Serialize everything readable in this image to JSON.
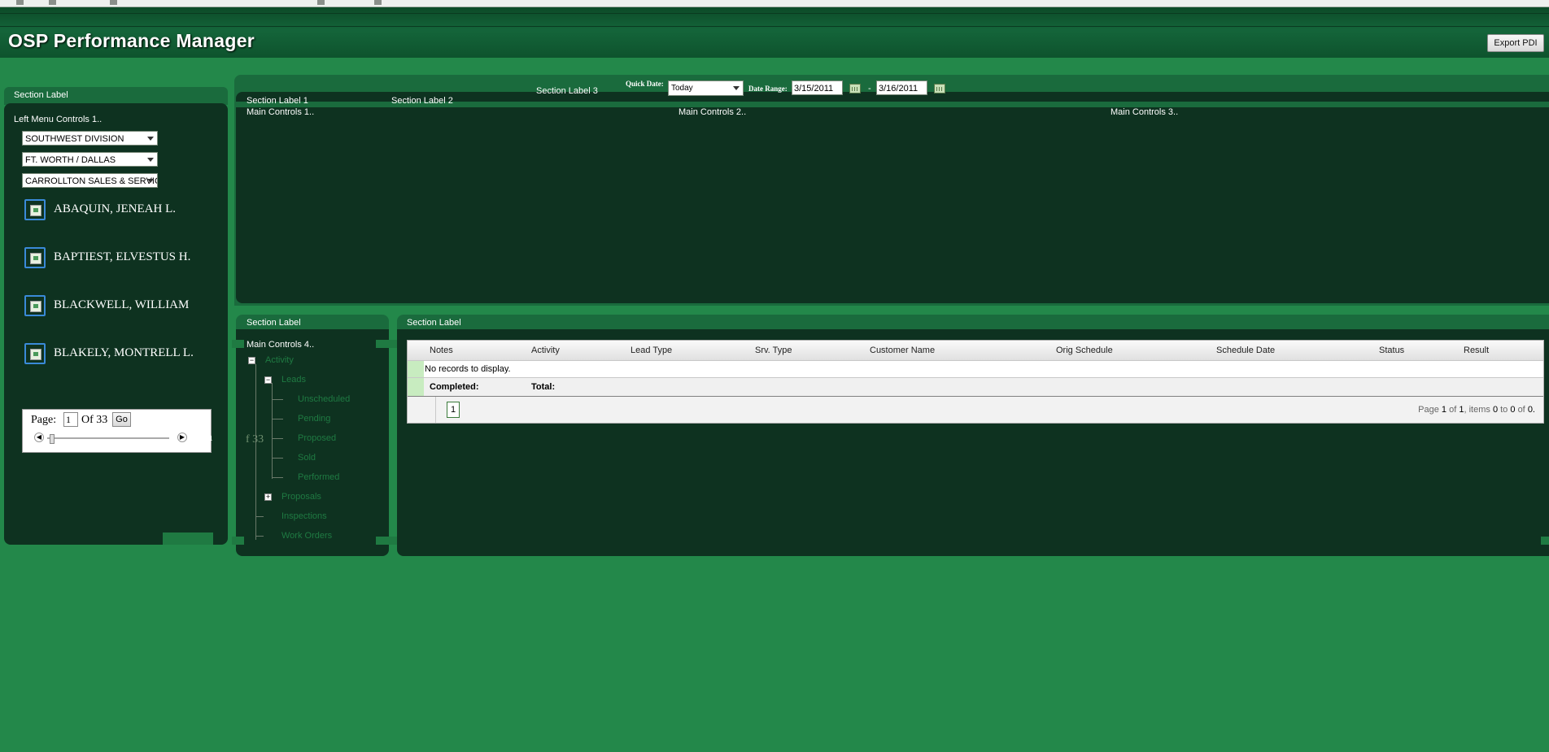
{
  "app": {
    "title": "OSP Performance Manager",
    "export_label": "Export PDI"
  },
  "left_panel": {
    "section_label": "Section Label",
    "controls_label": "Left Menu Controls 1..",
    "dropdowns": [
      "SOUTHWEST DIVISION",
      "FT. WORTH / DALLAS",
      "CARROLLTON SALES & SERVICE"
    ],
    "people": [
      "ABAQUIN, JENEAH L.",
      "BAPTIEST, ELVESTUS H.",
      "BLACKWELL, WILLIAM",
      "BLAKELY, MONTRELL L."
    ],
    "pager": {
      "page_label": "Page:",
      "page_value": "1",
      "of_label": "Of 33",
      "go_label": "Go",
      "overflow_text": "Pa",
      "ghost_text": "f 33"
    }
  },
  "top_panel": {
    "section_label_3": "Section Label 3",
    "quick_date_label": "Quick Date:",
    "quick_date_value": "Today",
    "date_range_label": "Date Range:",
    "date_from": "3/15/2011",
    "date_sep": "-",
    "date_to": "3/16/2011",
    "section_label_1": "Section Label 1",
    "section_label_2": "Section Label 2",
    "main_controls_1": "Main Controls 1..",
    "main_controls_2": "Main Controls 2..",
    "main_controls_3": "Main Controls 3.."
  },
  "tree_panel": {
    "section_label": "Section Label",
    "controls_label": "Main Controls 4..",
    "items": {
      "activity": "Activity",
      "leads": "Leads",
      "unscheduled": "Unscheduled",
      "pending": "Pending",
      "proposed": "Proposed",
      "sold": "Sold",
      "performed": "Performed",
      "proposals": "Proposals",
      "inspections": "Inspections",
      "work_orders": "Work Orders"
    }
  },
  "grid_panel": {
    "section_label": "Section Label",
    "columns": [
      "Notes",
      "Activity",
      "Lead Type",
      "Srv. Type",
      "Customer Name",
      "Orig Schedule",
      "Schedule Date",
      "Status",
      "Result"
    ],
    "empty_text": "No records to display.",
    "completed_label": "Completed:",
    "total_label": "Total:",
    "page_button": "1",
    "page_info": {
      "prefix": "Page",
      "page": "1",
      "of": "of",
      "pages": "1",
      "items": ", items",
      "from": "0",
      "to": "to",
      "to_val": "0",
      "of2": "of",
      "total": "0."
    }
  },
  "colors": {
    "background": "#23884a",
    "panel": "#0e3220",
    "header": "#14653a",
    "accent_blue": "#3a8ad8"
  }
}
